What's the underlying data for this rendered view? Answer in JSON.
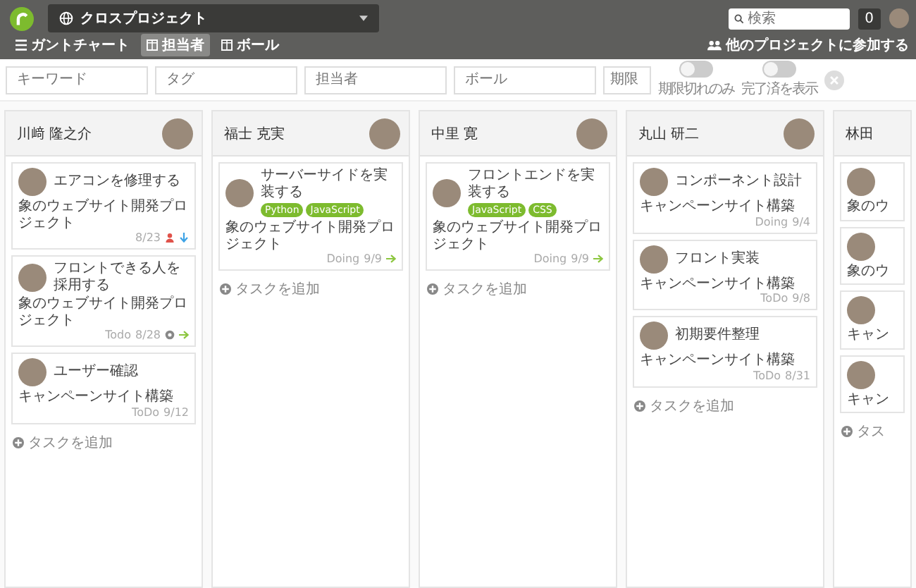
{
  "header": {
    "project": "クロスプロジェクト",
    "search": {
      "placeholder": "検索"
    },
    "notification_count": "0"
  },
  "nav": {
    "tabs": [
      {
        "label": "ガントチャート",
        "selected": false
      },
      {
        "label": "担当者",
        "selected": true
      },
      {
        "label": "ボール",
        "selected": false
      }
    ],
    "join_link": "他のプロジェクトに参加する"
  },
  "filters": {
    "fields": [
      {
        "placeholder": "キーワード"
      },
      {
        "placeholder": "タグ"
      },
      {
        "placeholder": "担当者"
      },
      {
        "placeholder": "ボール"
      }
    ],
    "date": {
      "placeholder": "期限"
    },
    "toggles": [
      {
        "label": "期限切れのみ",
        "on": false
      },
      {
        "label": "完了済を表示",
        "on": false
      }
    ]
  },
  "columns": [
    {
      "name": "川﨑 隆之介",
      "add_label": "タスクを追加",
      "cards": [
        {
          "title": "エアコンを修理する",
          "project": "象のウェブサイト開発プロジェクト",
          "date": "8/23",
          "icons": [
            {
              "kind": "person"
            },
            {
              "kind": "down"
            }
          ]
        },
        {
          "title": "フロントできる人を採用する",
          "project": "象のウェブサイト開発プロジェクト",
          "status": "Todo",
          "date": "8/28",
          "icons": [
            {
              "kind": "gear"
            },
            {
              "kind": "right"
            }
          ]
        },
        {
          "title": "ユーザー確認",
          "project": "キャンペーンサイト構築",
          "status": "ToDo",
          "date": "9/12"
        }
      ]
    },
    {
      "name": "福士 克実",
      "add_label": "タスクを追加",
      "cards": [
        {
          "title": "サーバーサイドを実装する",
          "tags": [
            "Python",
            "JavaScript"
          ],
          "project": "象のウェブサイト開発プロジェクト",
          "status": "Doing",
          "date": "9/9",
          "icons": [
            {
              "kind": "right"
            }
          ]
        }
      ]
    },
    {
      "name": "中里 寛",
      "add_label": "タスクを追加",
      "cards": [
        {
          "title": "フロントエンドを実装する",
          "tags": [
            "JavaScript",
            "CSS"
          ],
          "project": "象のウェブサイト開発プロジェクト",
          "status": "Doing",
          "date": "9/9",
          "icons": [
            {
              "kind": "right"
            }
          ]
        }
      ]
    },
    {
      "name": "丸山 研二",
      "add_label": "タスクを追加",
      "cards": [
        {
          "title": "コンポーネント設計",
          "project": "キャンペーンサイト構築",
          "status": "Doing",
          "date": "9/4"
        },
        {
          "title": "フロント実装",
          "project": "キャンペーンサイト構築",
          "status": "ToDo",
          "date": "9/8"
        },
        {
          "title": "初期要件整理",
          "project": "キャンペーンサイト構築",
          "status": "ToDo",
          "date": "8/31"
        }
      ]
    },
    {
      "name": "林田",
      "add_label": "タス",
      "cards": [
        {
          "project": "象のウ"
        },
        {
          "project": "象のウ"
        },
        {
          "project": "キャン"
        },
        {
          "project": "キャン"
        }
      ]
    }
  ]
}
